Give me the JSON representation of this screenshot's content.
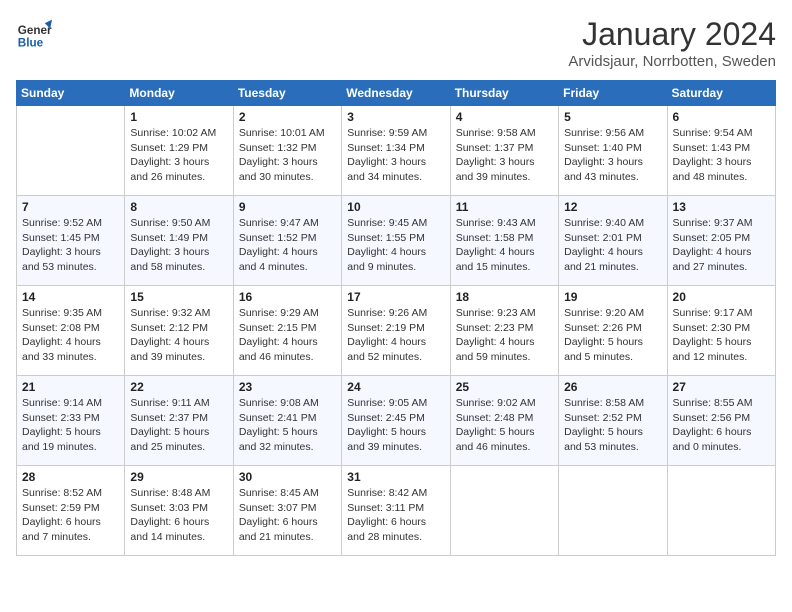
{
  "logo": {
    "general": "General",
    "blue": "Blue"
  },
  "header": {
    "month": "January 2024",
    "location": "Arvidsjaur, Norrbotten, Sweden"
  },
  "weekdays": [
    "Sunday",
    "Monday",
    "Tuesday",
    "Wednesday",
    "Thursday",
    "Friday",
    "Saturday"
  ],
  "weeks": [
    [
      {
        "day": "",
        "sunrise": "",
        "sunset": "",
        "daylight": ""
      },
      {
        "day": "1",
        "sunrise": "Sunrise: 10:02 AM",
        "sunset": "Sunset: 1:29 PM",
        "daylight": "Daylight: 3 hours and 26 minutes."
      },
      {
        "day": "2",
        "sunrise": "Sunrise: 10:01 AM",
        "sunset": "Sunset: 1:32 PM",
        "daylight": "Daylight: 3 hours and 30 minutes."
      },
      {
        "day": "3",
        "sunrise": "Sunrise: 9:59 AM",
        "sunset": "Sunset: 1:34 PM",
        "daylight": "Daylight: 3 hours and 34 minutes."
      },
      {
        "day": "4",
        "sunrise": "Sunrise: 9:58 AM",
        "sunset": "Sunset: 1:37 PM",
        "daylight": "Daylight: 3 hours and 39 minutes."
      },
      {
        "day": "5",
        "sunrise": "Sunrise: 9:56 AM",
        "sunset": "Sunset: 1:40 PM",
        "daylight": "Daylight: 3 hours and 43 minutes."
      },
      {
        "day": "6",
        "sunrise": "Sunrise: 9:54 AM",
        "sunset": "Sunset: 1:43 PM",
        "daylight": "Daylight: 3 hours and 48 minutes."
      }
    ],
    [
      {
        "day": "7",
        "sunrise": "Sunrise: 9:52 AM",
        "sunset": "Sunset: 1:45 PM",
        "daylight": "Daylight: 3 hours and 53 minutes."
      },
      {
        "day": "8",
        "sunrise": "Sunrise: 9:50 AM",
        "sunset": "Sunset: 1:49 PM",
        "daylight": "Daylight: 3 hours and 58 minutes."
      },
      {
        "day": "9",
        "sunrise": "Sunrise: 9:47 AM",
        "sunset": "Sunset: 1:52 PM",
        "daylight": "Daylight: 4 hours and 4 minutes."
      },
      {
        "day": "10",
        "sunrise": "Sunrise: 9:45 AM",
        "sunset": "Sunset: 1:55 PM",
        "daylight": "Daylight: 4 hours and 9 minutes."
      },
      {
        "day": "11",
        "sunrise": "Sunrise: 9:43 AM",
        "sunset": "Sunset: 1:58 PM",
        "daylight": "Daylight: 4 hours and 15 minutes."
      },
      {
        "day": "12",
        "sunrise": "Sunrise: 9:40 AM",
        "sunset": "Sunset: 2:01 PM",
        "daylight": "Daylight: 4 hours and 21 minutes."
      },
      {
        "day": "13",
        "sunrise": "Sunrise: 9:37 AM",
        "sunset": "Sunset: 2:05 PM",
        "daylight": "Daylight: 4 hours and 27 minutes."
      }
    ],
    [
      {
        "day": "14",
        "sunrise": "Sunrise: 9:35 AM",
        "sunset": "Sunset: 2:08 PM",
        "daylight": "Daylight: 4 hours and 33 minutes."
      },
      {
        "day": "15",
        "sunrise": "Sunrise: 9:32 AM",
        "sunset": "Sunset: 2:12 PM",
        "daylight": "Daylight: 4 hours and 39 minutes."
      },
      {
        "day": "16",
        "sunrise": "Sunrise: 9:29 AM",
        "sunset": "Sunset: 2:15 PM",
        "daylight": "Daylight: 4 hours and 46 minutes."
      },
      {
        "day": "17",
        "sunrise": "Sunrise: 9:26 AM",
        "sunset": "Sunset: 2:19 PM",
        "daylight": "Daylight: 4 hours and 52 minutes."
      },
      {
        "day": "18",
        "sunrise": "Sunrise: 9:23 AM",
        "sunset": "Sunset: 2:23 PM",
        "daylight": "Daylight: 4 hours and 59 minutes."
      },
      {
        "day": "19",
        "sunrise": "Sunrise: 9:20 AM",
        "sunset": "Sunset: 2:26 PM",
        "daylight": "Daylight: 5 hours and 5 minutes."
      },
      {
        "day": "20",
        "sunrise": "Sunrise: 9:17 AM",
        "sunset": "Sunset: 2:30 PM",
        "daylight": "Daylight: 5 hours and 12 minutes."
      }
    ],
    [
      {
        "day": "21",
        "sunrise": "Sunrise: 9:14 AM",
        "sunset": "Sunset: 2:33 PM",
        "daylight": "Daylight: 5 hours and 19 minutes."
      },
      {
        "day": "22",
        "sunrise": "Sunrise: 9:11 AM",
        "sunset": "Sunset: 2:37 PM",
        "daylight": "Daylight: 5 hours and 25 minutes."
      },
      {
        "day": "23",
        "sunrise": "Sunrise: 9:08 AM",
        "sunset": "Sunset: 2:41 PM",
        "daylight": "Daylight: 5 hours and 32 minutes."
      },
      {
        "day": "24",
        "sunrise": "Sunrise: 9:05 AM",
        "sunset": "Sunset: 2:45 PM",
        "daylight": "Daylight: 5 hours and 39 minutes."
      },
      {
        "day": "25",
        "sunrise": "Sunrise: 9:02 AM",
        "sunset": "Sunset: 2:48 PM",
        "daylight": "Daylight: 5 hours and 46 minutes."
      },
      {
        "day": "26",
        "sunrise": "Sunrise: 8:58 AM",
        "sunset": "Sunset: 2:52 PM",
        "daylight": "Daylight: 5 hours and 53 minutes."
      },
      {
        "day": "27",
        "sunrise": "Sunrise: 8:55 AM",
        "sunset": "Sunset: 2:56 PM",
        "daylight": "Daylight: 6 hours and 0 minutes."
      }
    ],
    [
      {
        "day": "28",
        "sunrise": "Sunrise: 8:52 AM",
        "sunset": "Sunset: 2:59 PM",
        "daylight": "Daylight: 6 hours and 7 minutes."
      },
      {
        "day": "29",
        "sunrise": "Sunrise: 8:48 AM",
        "sunset": "Sunset: 3:03 PM",
        "daylight": "Daylight: 6 hours and 14 minutes."
      },
      {
        "day": "30",
        "sunrise": "Sunrise: 8:45 AM",
        "sunset": "Sunset: 3:07 PM",
        "daylight": "Daylight: 6 hours and 21 minutes."
      },
      {
        "day": "31",
        "sunrise": "Sunrise: 8:42 AM",
        "sunset": "Sunset: 3:11 PM",
        "daylight": "Daylight: 6 hours and 28 minutes."
      },
      {
        "day": "",
        "sunrise": "",
        "sunset": "",
        "daylight": ""
      },
      {
        "day": "",
        "sunrise": "",
        "sunset": "",
        "daylight": ""
      },
      {
        "day": "",
        "sunrise": "",
        "sunset": "",
        "daylight": ""
      }
    ]
  ]
}
